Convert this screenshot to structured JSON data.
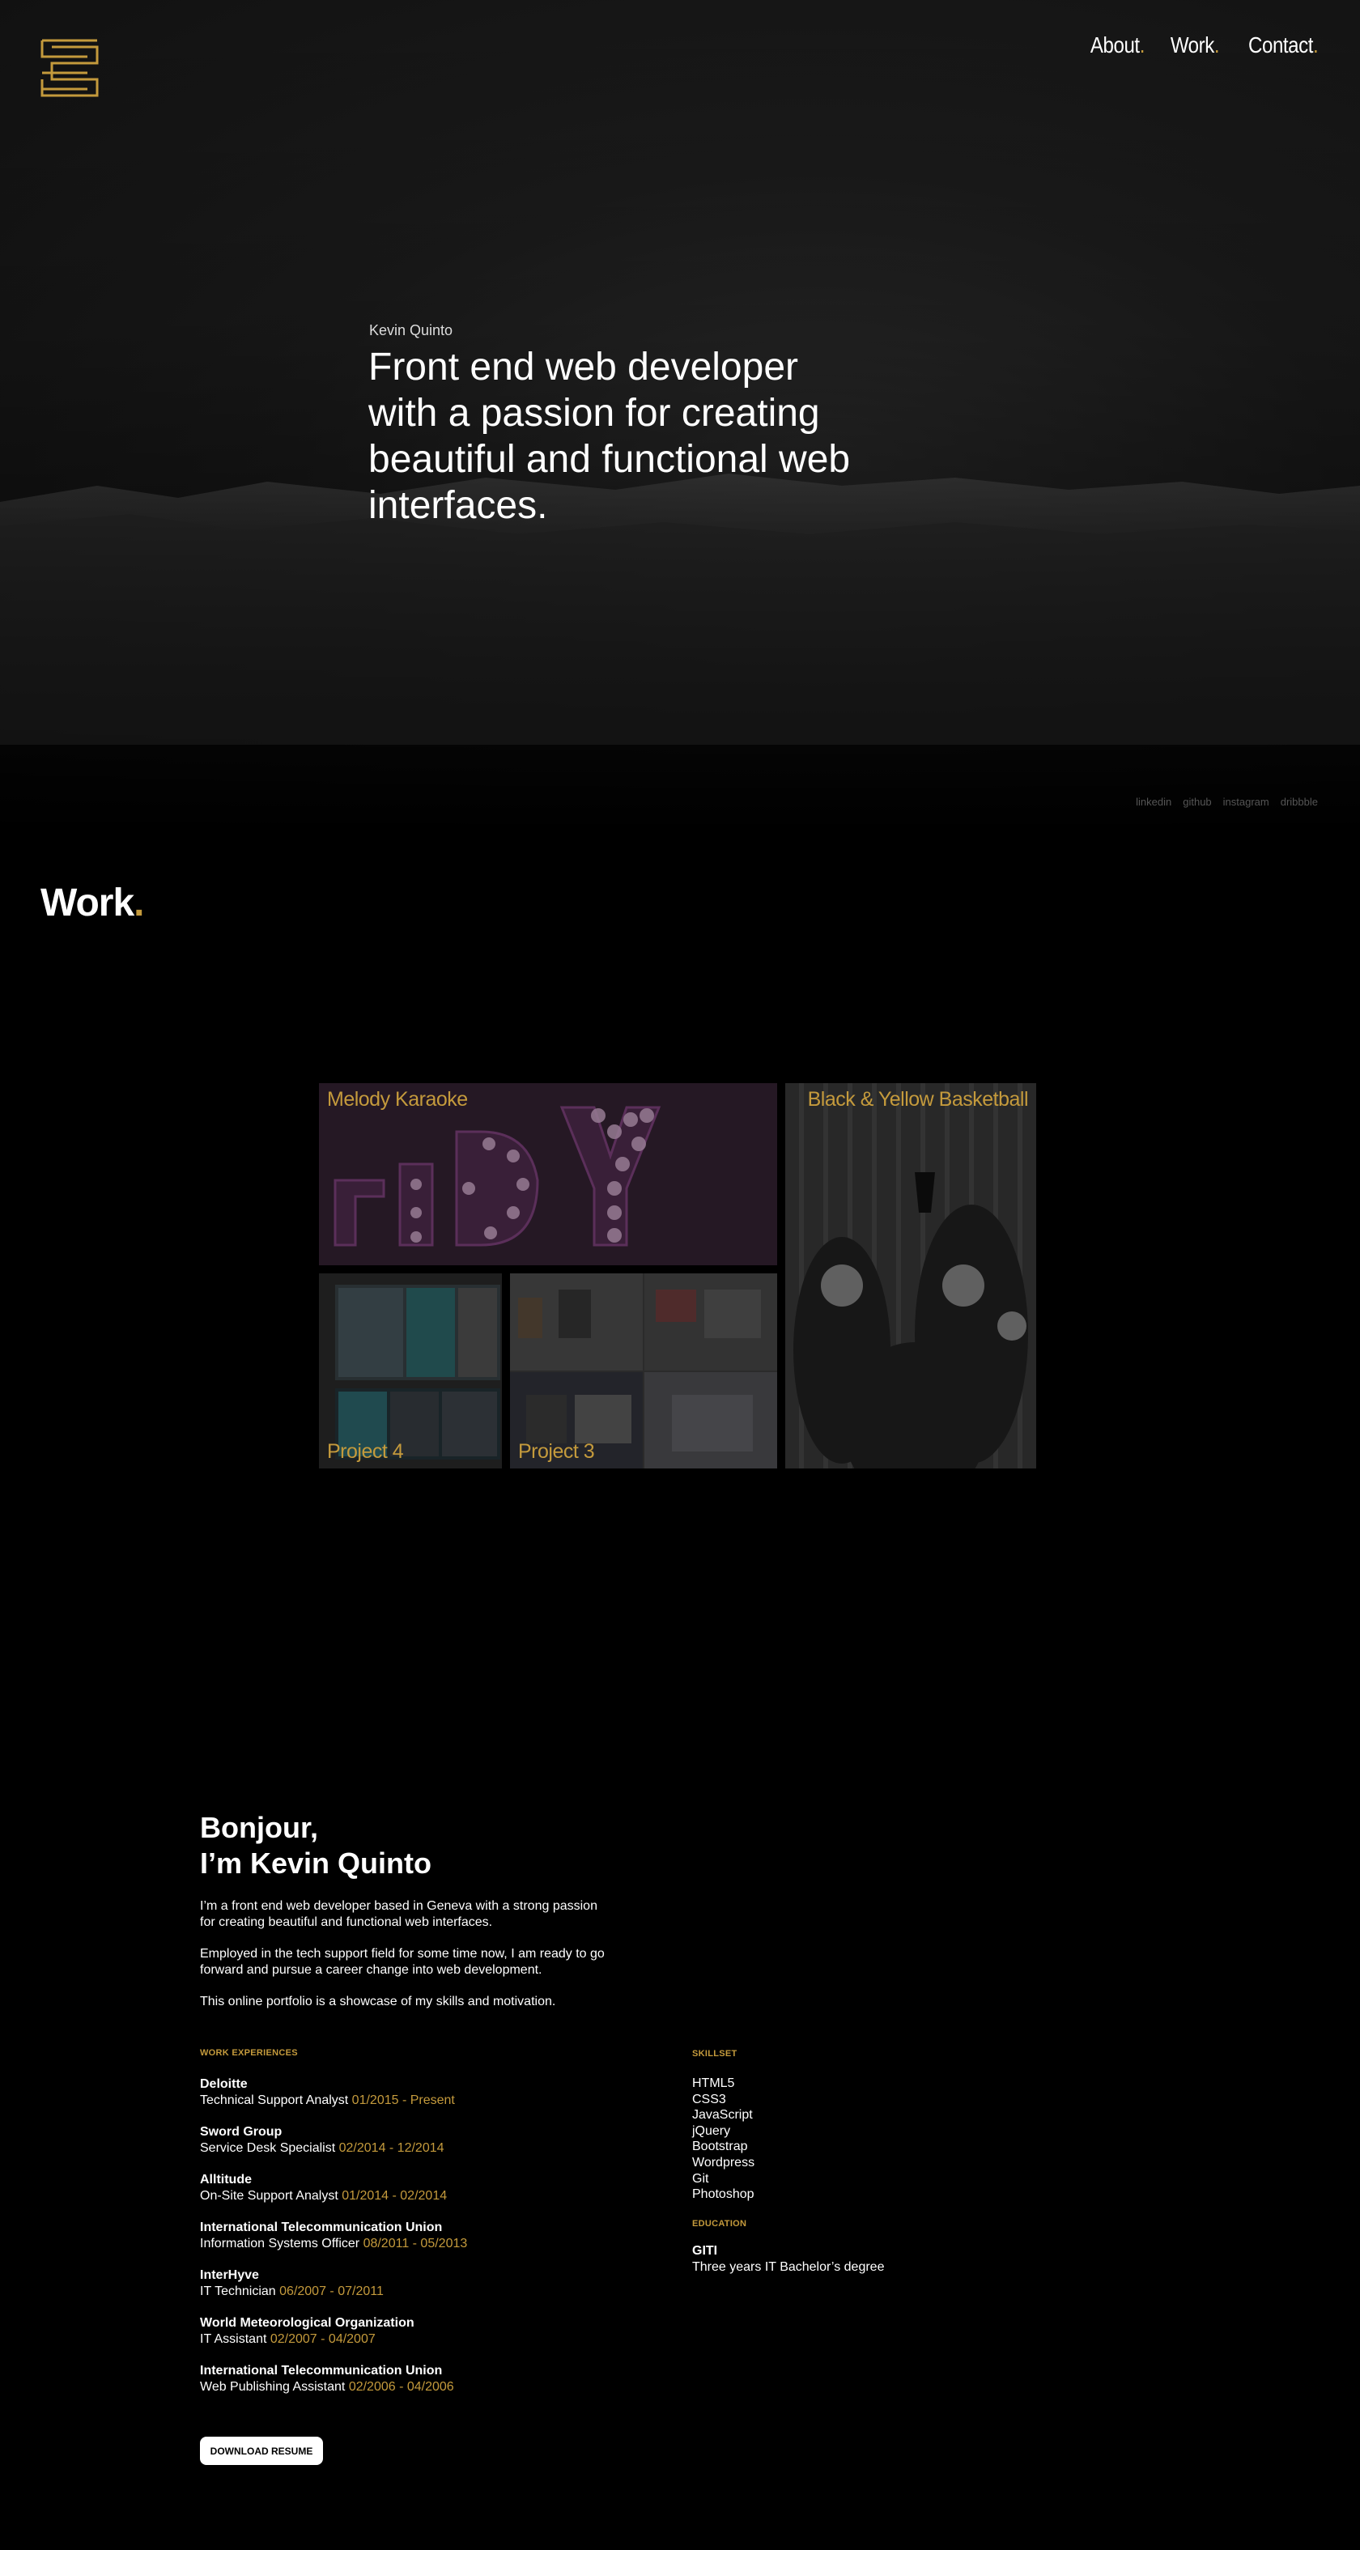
{
  "nav": {
    "items": [
      {
        "label": "About",
        "dot": "."
      },
      {
        "label": "Work",
        "dot": "."
      },
      {
        "label": "Contact",
        "dot": "."
      }
    ]
  },
  "hero": {
    "name": "Kevin Quinto",
    "title": "Front end web developer with a passion for creating beautiful and functional web interfaces."
  },
  "socials": [
    "linkedin",
    "github",
    "instagram",
    "dribbble"
  ],
  "work": {
    "heading": "Work",
    "dot": ".",
    "projects": [
      {
        "label": "Melody Karaoke"
      },
      {
        "label": "Black & Yellow Basketball"
      },
      {
        "label": "Project 4"
      },
      {
        "label": "Project 3"
      }
    ]
  },
  "about": {
    "greeting_line1": "Bonjour,",
    "greeting_line2": "I’m Kevin Quinto",
    "paragraphs": [
      "I’m a front end web developer based in Geneva with a strong passion for creating beautiful and functional web interfaces.",
      "Employed in the tech support field for some time now, I am ready to go forward and pursue a career change into web development.",
      "This online portfolio is a showcase of my skills and motivation."
    ],
    "work_label": "WORK EXPERIENCES",
    "jobs": [
      {
        "company": "Deloitte",
        "role": "Technical Support Analyst",
        "period": "01/2015 - Present"
      },
      {
        "company": "Sword Group",
        "role": "Service Desk Specialist",
        "period": "02/2014 - 12/2014"
      },
      {
        "company": "Alltitude",
        "role": "On-Site Support Analyst",
        "period": "01/2014 - 02/2014"
      },
      {
        "company": "International Telecommunication Union",
        "role": "Information Systems Officer",
        "period": "08/2011 - 05/2013"
      },
      {
        "company": "InterHyve",
        "role": "IT Technician",
        "period": "06/2007 - 07/2011"
      },
      {
        "company": "World Meteorological Organization",
        "role": "IT Assistant",
        "period": "02/2007 - 04/2007"
      },
      {
        "company": "International Telecommunication Union",
        "role": "Web Publishing Assistant",
        "period": "02/2006 - 04/2006"
      }
    ],
    "skills_label": "SKILLSET",
    "skills": [
      "HTML5",
      "CSS3",
      "JavaScript",
      "jQuery",
      "Bootstrap",
      "Wordpress",
      "Git",
      "Photoshop"
    ],
    "education_label": "EDUCATION",
    "education": {
      "school": "GITI",
      "degree": "Three years IT Bachelor’s degree"
    },
    "resume_button": "DOWNLOAD RESUME"
  },
  "colors": {
    "accent": "#c49a3c",
    "background": "#000000"
  }
}
